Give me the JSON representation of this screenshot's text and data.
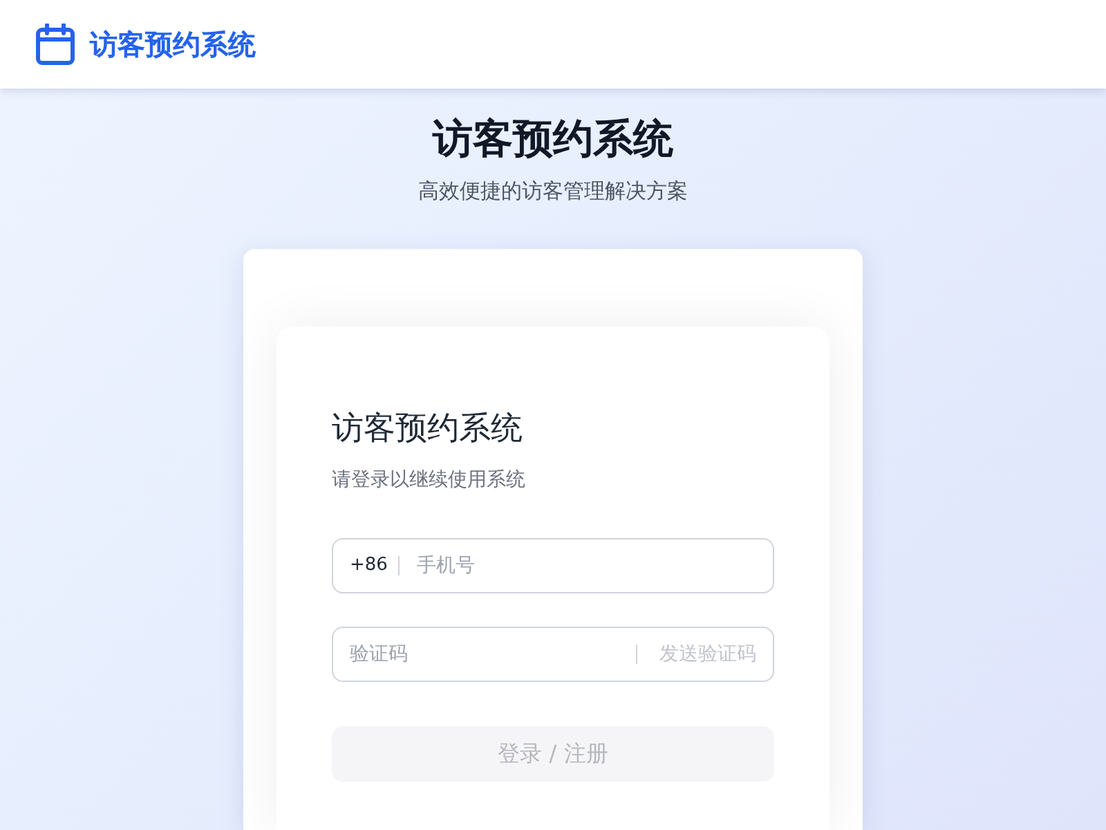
{
  "header": {
    "brand": "访客预约系统"
  },
  "hero": {
    "title": "访客预约系统",
    "subtitle": "高效便捷的访客管理解决方案"
  },
  "login_card": {
    "title": "访客预约系统",
    "subtitle": "请登录以继续使用系统",
    "phone_field": {
      "prefix": "+86",
      "placeholder": "手机号"
    },
    "code_field": {
      "placeholder": "验证码",
      "send_button": {
        "label": "发送验证码",
        "disabled": true
      }
    },
    "submit_button": {
      "label": "登录 / 注册",
      "disabled": true
    }
  }
}
